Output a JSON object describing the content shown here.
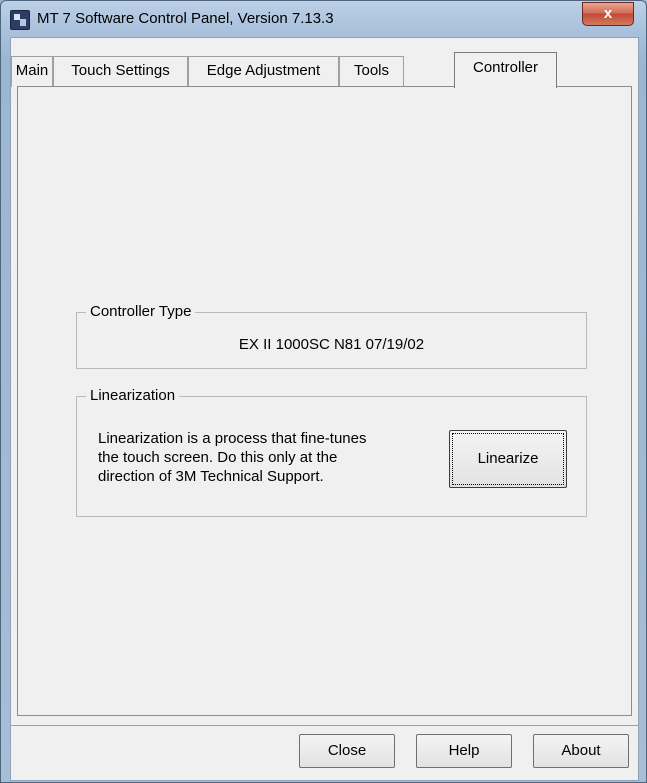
{
  "window": {
    "title": "MT 7 Software Control Panel, Version 7.13.3",
    "close_glyph": "x"
  },
  "tabs": [
    {
      "label": "Main"
    },
    {
      "label": "Touch Settings"
    },
    {
      "label": "Edge Adjustment"
    },
    {
      "label": "Tools"
    },
    {
      "label": "Controller",
      "active": true
    }
  ],
  "controller_type": {
    "group_label": "Controller Type",
    "value": "EX II 1000SC N81 07/19/02"
  },
  "linearization": {
    "group_label": "Linearization",
    "description_lines": [
      "Linearization is a process that fine-tunes",
      "the touch screen. Do this only at the",
      "direction of 3M Technical Support."
    ],
    "button_label": "Linearize"
  },
  "footer": {
    "close_label": "Close",
    "help_label": "Help",
    "about_label": "About"
  },
  "icons": [
    "app-icon",
    "close-icon"
  ]
}
